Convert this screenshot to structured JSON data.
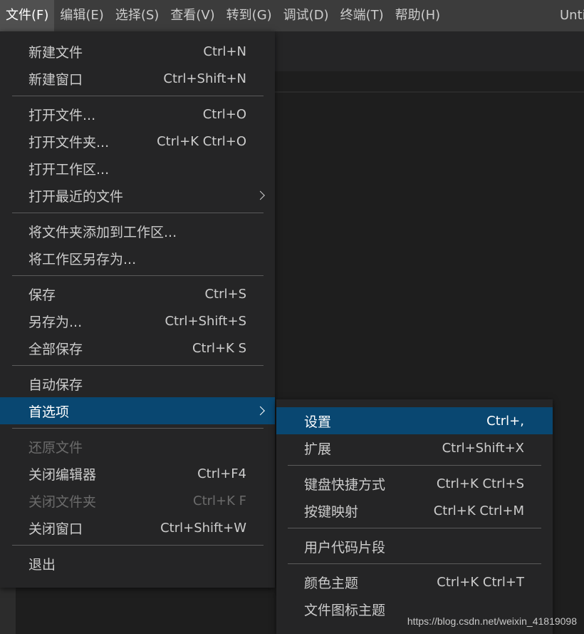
{
  "menubar": {
    "items": [
      {
        "label": "文件(F)"
      },
      {
        "label": "编辑(E)"
      },
      {
        "label": "选择(S)"
      },
      {
        "label": "查看(V)"
      },
      {
        "label": "转到(G)"
      },
      {
        "label": "调试(D)"
      },
      {
        "label": "终端(T)"
      },
      {
        "label": "帮助(H)"
      }
    ],
    "title": "Untit"
  },
  "file_menu": {
    "items": [
      {
        "label": "新建文件",
        "key": "Ctrl+N"
      },
      {
        "label": "新建窗口",
        "key": "Ctrl+Shift+N"
      },
      {
        "label": "打开文件...",
        "key": "Ctrl+O"
      },
      {
        "label": "打开文件夹...",
        "key": "Ctrl+K Ctrl+O"
      },
      {
        "label": "打开工作区...",
        "key": ""
      },
      {
        "label": "打开最近的文件",
        "key": ""
      },
      {
        "label": "将文件夹添加到工作区...",
        "key": ""
      },
      {
        "label": "将工作区另存为...",
        "key": ""
      },
      {
        "label": "保存",
        "key": "Ctrl+S"
      },
      {
        "label": "另存为...",
        "key": "Ctrl+Shift+S"
      },
      {
        "label": "全部保存",
        "key": "Ctrl+K S"
      },
      {
        "label": "自动保存",
        "key": ""
      },
      {
        "label": "首选项",
        "key": ""
      },
      {
        "label": "还原文件",
        "key": ""
      },
      {
        "label": "关闭编辑器",
        "key": "Ctrl+F4"
      },
      {
        "label": "关闭文件夹",
        "key": "Ctrl+K F"
      },
      {
        "label": "关闭窗口",
        "key": "Ctrl+Shift+W"
      },
      {
        "label": "退出",
        "key": ""
      }
    ]
  },
  "preferences_menu": {
    "items": [
      {
        "label": "设置",
        "key": "Ctrl+,"
      },
      {
        "label": "扩展",
        "key": "Ctrl+Shift+X"
      },
      {
        "label": "键盘快捷方式",
        "key": "Ctrl+K Ctrl+S"
      },
      {
        "label": "按键映射",
        "key": "Ctrl+K Ctrl+M"
      },
      {
        "label": "用户代码片段",
        "key": ""
      },
      {
        "label": "颜色主题",
        "key": "Ctrl+K Ctrl+T"
      },
      {
        "label": "文件图标主题",
        "key": ""
      }
    ]
  },
  "watermark": "https://blog.csdn.net/weixin_41819098",
  "colors": {
    "menubar_bg": "#3c3c3c",
    "menu_bg": "#252526",
    "selection_bg": "#094771",
    "editor_bg": "#1e1e1e",
    "disabled_text": "#6b6b6b"
  }
}
